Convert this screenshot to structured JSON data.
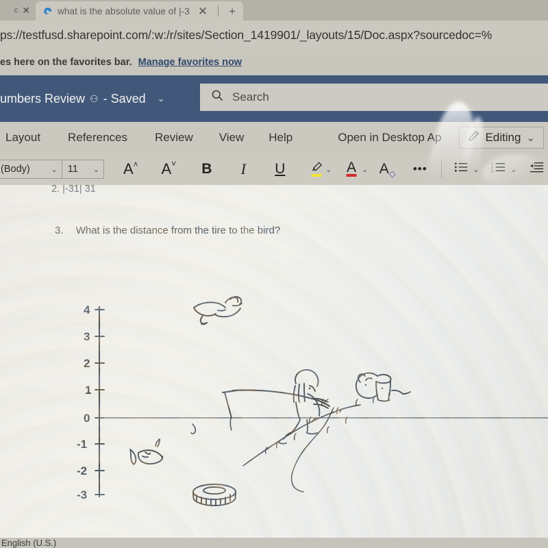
{
  "browser": {
    "tab_partial_label": "c",
    "tab_partial_close": "✕",
    "active_tab": {
      "favicon_name": "edge-favicon",
      "title": "what is the absolute value of |-3",
      "close": "✕"
    },
    "new_tab": "+",
    "url": "ps://testfusd.sharepoint.com/:w:/r/sites/Section_1419901/_layouts/15/Doc.aspx?sourcedoc=%",
    "favorites": {
      "text": "es here on the favorites bar.",
      "link": "Manage favorites now"
    }
  },
  "word": {
    "header": {
      "doc_title": "umbers Review",
      "person_glyph": "⚇",
      "saved_status": "- Saved",
      "title_chevron": "⌄",
      "header_color": "#42587a"
    },
    "search": {
      "icon": "search-icon",
      "placeholder": "Search"
    },
    "ribbon_tabs": [
      {
        "label": "Layout"
      },
      {
        "label": "References"
      },
      {
        "label": "Review"
      },
      {
        "label": "View"
      },
      {
        "label": "Help"
      },
      {
        "label": "Open in Desktop Ap"
      }
    ],
    "editing_button": {
      "icon": "pencil-icon",
      "label": "Editing",
      "chevron": "⌄"
    },
    "format_bar": {
      "font_name": "(Body)",
      "font_size": "11",
      "chevron": "⌄",
      "grow_font": "A",
      "grow_font_mark": "˄",
      "shrink_font": "A",
      "shrink_font_mark": "˅",
      "bold": "B",
      "italic": "I",
      "underline": "U",
      "highlight": "✎",
      "highlight_color": "#f2e23a",
      "font_color": "A",
      "font_color_value": "#d22a2a",
      "clear_format": "A",
      "clear_format_mark": "◇",
      "clear_format_color": "#7a4fa8",
      "more": "•••",
      "bullets": "bullet-list-icon",
      "numbering": "numbered-list-icon",
      "decrease_indent": "decrease-indent-icon"
    },
    "document": {
      "question_2": "2.   |-31| 31",
      "question_3_number": "3.",
      "question_3_text": "What is the distance from the tire to the bird?",
      "figure": {
        "name": "number-line-fishing-illustration",
        "axis_labels": [
          "4",
          "3",
          "2",
          "1",
          "0",
          "-1",
          "-2",
          "-3"
        ],
        "objects": [
          "bird",
          "fishing-rod",
          "person-fishing",
          "dog-on-bank",
          "fish",
          "tire",
          "water-line"
        ]
      }
    },
    "status_bar": {
      "language": "English (U.S.)"
    }
  }
}
